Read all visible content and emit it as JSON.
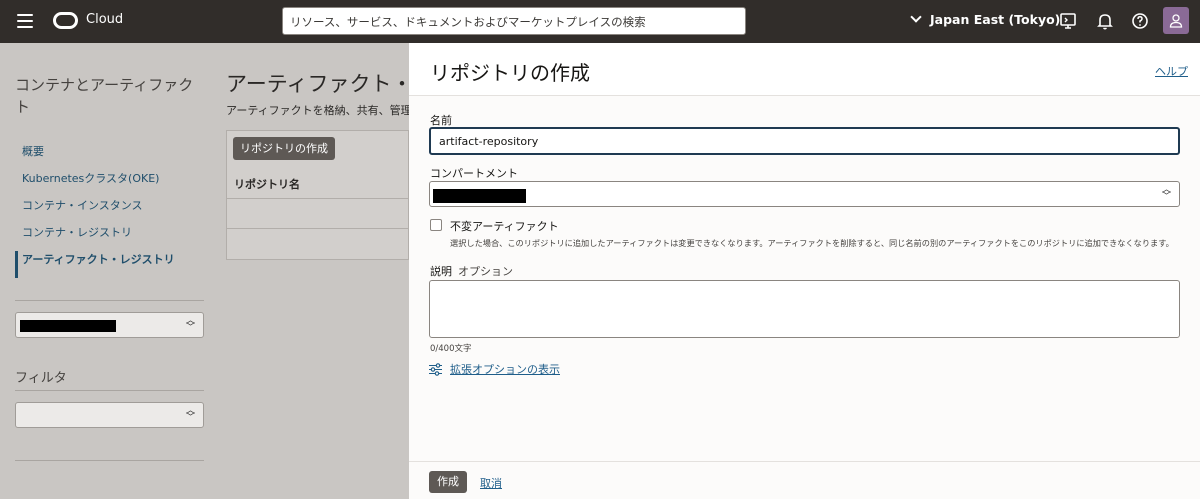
{
  "header": {
    "cloud_label": "Cloud",
    "search_placeholder": "リソース、サービス、ドキュメントおよびマーケットプレイスの検索",
    "region": "Japan East (Tokyo)",
    "icons": [
      "menu-icon",
      "oracle-logo",
      "cloud-shell-icon",
      "notifications-icon",
      "help-icon",
      "user-avatar-icon"
    ]
  },
  "sidebar": {
    "title": "コンテナとアーティファクト",
    "items": [
      {
        "label": "概要"
      },
      {
        "label": "Kubernetesクラスタ(OKE)"
      },
      {
        "label": "コンテナ・インスタンス"
      },
      {
        "label": "コンテナ・レジストリ"
      },
      {
        "label": "アーティファクト・レジストリ"
      }
    ],
    "filter_label": "フィルタ"
  },
  "main": {
    "title": "アーティファクト・レジストリ",
    "subtitle": "アーティファクトを格納、共有、管理するためのリポジトリを作成します。",
    "create_button": "リポジトリの作成",
    "column_name": "リポジトリ名"
  },
  "panel": {
    "title": "リポジトリの作成",
    "help_link": "ヘルプ",
    "name_label": "名前",
    "name_value": "artifact-repository",
    "compartment_label": "コンパートメント",
    "immutable_label": "不変アーティファクト",
    "immutable_help": "選択した場合、このリポジトリに追加したアーティファクトは変更できなくなります。アーティファクトを削除すると、同じ名前の別のアーティファクトをこのリポジトリに追加できなくなります。",
    "description_label": "説明",
    "optional_label": "オプション",
    "char_counter": "0/400文字",
    "advanced_link": "拡張オプションの表示",
    "create_button": "作成",
    "cancel_link": "取消"
  },
  "colors": {
    "header_bg": "#312d2a",
    "link": "#1f5e8a",
    "button_bg": "#5e5955"
  }
}
